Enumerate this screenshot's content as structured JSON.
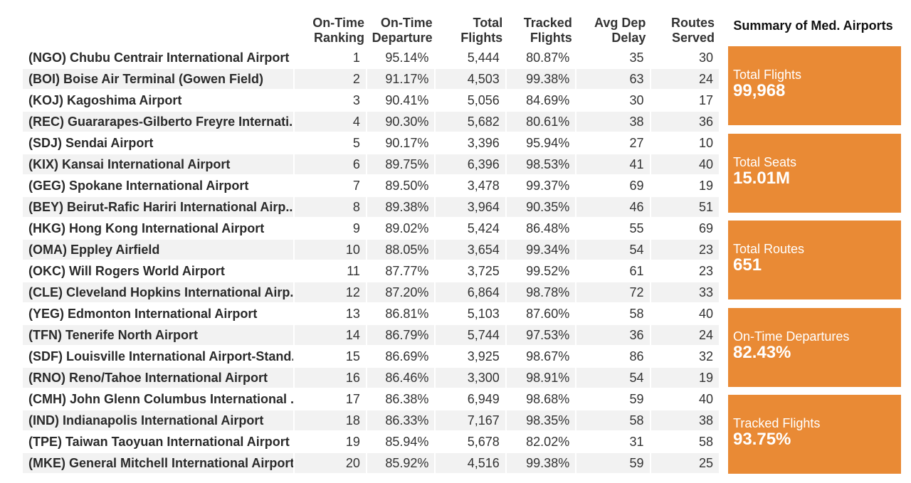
{
  "table": {
    "headers": {
      "name": "",
      "rank": [
        "On-Time",
        "Ranking"
      ],
      "departure": [
        "On-Time",
        "Departure"
      ],
      "total_flights": [
        "Total",
        "Flights"
      ],
      "tracked_flights": [
        "Tracked",
        "Flights"
      ],
      "avg_dep_delay": [
        "Avg Dep",
        "Delay"
      ],
      "routes_served": [
        "Routes",
        "Served"
      ]
    },
    "rows": [
      {
        "name": "(NGO) Chubu Centrair International Airport",
        "rank": "1",
        "departure": "95.14%",
        "total_flights": "5,444",
        "tracked_flights": "80.87%",
        "avg_dep_delay": "35",
        "routes_served": "30"
      },
      {
        "name": "(BOI) Boise Air Terminal (Gowen Field)",
        "rank": "2",
        "departure": "91.17%",
        "total_flights": "4,503",
        "tracked_flights": "99.38%",
        "avg_dep_delay": "63",
        "routes_served": "24"
      },
      {
        "name": "(KOJ) Kagoshima Airport",
        "rank": "3",
        "departure": "90.41%",
        "total_flights": "5,056",
        "tracked_flights": "84.69%",
        "avg_dep_delay": "30",
        "routes_served": "17"
      },
      {
        "name": "(REC) Guararapes-Gilberto Freyre Internati..",
        "rank": "4",
        "departure": "90.30%",
        "total_flights": "5,682",
        "tracked_flights": "80.61%",
        "avg_dep_delay": "38",
        "routes_served": "36"
      },
      {
        "name": "(SDJ) Sendai Airport",
        "rank": "5",
        "departure": "90.17%",
        "total_flights": "3,396",
        "tracked_flights": "95.94%",
        "avg_dep_delay": "27",
        "routes_served": "10"
      },
      {
        "name": "(KIX) Kansai International Airport",
        "rank": "6",
        "departure": "89.75%",
        "total_flights": "6,396",
        "tracked_flights": "98.53%",
        "avg_dep_delay": "41",
        "routes_served": "40"
      },
      {
        "name": "(GEG) Spokane International Airport",
        "rank": "7",
        "departure": "89.50%",
        "total_flights": "3,478",
        "tracked_flights": "99.37%",
        "avg_dep_delay": "69",
        "routes_served": "19"
      },
      {
        "name": "(BEY) Beirut-Rafic Hariri International Airp..",
        "rank": "8",
        "departure": "89.38%",
        "total_flights": "3,964",
        "tracked_flights": "90.35%",
        "avg_dep_delay": "46",
        "routes_served": "51"
      },
      {
        "name": "(HKG) Hong Kong International Airport",
        "rank": "9",
        "departure": "89.02%",
        "total_flights": "5,424",
        "tracked_flights": "86.48%",
        "avg_dep_delay": "55",
        "routes_served": "69"
      },
      {
        "name": "(OMA) Eppley Airfield",
        "rank": "10",
        "departure": "88.05%",
        "total_flights": "3,654",
        "tracked_flights": "99.34%",
        "avg_dep_delay": "54",
        "routes_served": "23"
      },
      {
        "name": "(OKC) Will Rogers World Airport",
        "rank": "11",
        "departure": "87.77%",
        "total_flights": "3,725",
        "tracked_flights": "99.52%",
        "avg_dep_delay": "61",
        "routes_served": "23"
      },
      {
        "name": "(CLE) Cleveland Hopkins International Airp..",
        "rank": "12",
        "departure": "87.20%",
        "total_flights": "6,864",
        "tracked_flights": "98.78%",
        "avg_dep_delay": "72",
        "routes_served": "33"
      },
      {
        "name": "(YEG) Edmonton International Airport",
        "rank": "13",
        "departure": "86.81%",
        "total_flights": "5,103",
        "tracked_flights": "87.60%",
        "avg_dep_delay": "58",
        "routes_served": "40"
      },
      {
        "name": "(TFN) Tenerife North Airport",
        "rank": "14",
        "departure": "86.79%",
        "total_flights": "5,744",
        "tracked_flights": "97.53%",
        "avg_dep_delay": "36",
        "routes_served": "24"
      },
      {
        "name": "(SDF) Louisville International Airport-Stand..",
        "rank": "15",
        "departure": "86.69%",
        "total_flights": "3,925",
        "tracked_flights": "98.67%",
        "avg_dep_delay": "86",
        "routes_served": "32"
      },
      {
        "name": "(RNO) Reno/Tahoe International Airport",
        "rank": "16",
        "departure": "86.46%",
        "total_flights": "3,300",
        "tracked_flights": "98.91%",
        "avg_dep_delay": "54",
        "routes_served": "19"
      },
      {
        "name": "(CMH) John Glenn Columbus International ..",
        "rank": "17",
        "departure": "86.38%",
        "total_flights": "6,949",
        "tracked_flights": "98.68%",
        "avg_dep_delay": "59",
        "routes_served": "40"
      },
      {
        "name": "(IND) Indianapolis International Airport",
        "rank": "18",
        "departure": "86.33%",
        "total_flights": "7,167",
        "tracked_flights": "98.35%",
        "avg_dep_delay": "58",
        "routes_served": "38"
      },
      {
        "name": "(TPE) Taiwan Taoyuan International Airport",
        "rank": "19",
        "departure": "85.94%",
        "total_flights": "5,678",
        "tracked_flights": "82.02%",
        "avg_dep_delay": "31",
        "routes_served": "58"
      },
      {
        "name": "(MKE) General Mitchell International Airport",
        "rank": "20",
        "departure": "85.92%",
        "total_flights": "4,516",
        "tracked_flights": "99.38%",
        "avg_dep_delay": "59",
        "routes_served": "25"
      }
    ]
  },
  "summary": {
    "title": "Summary of Med. Airports",
    "accent_color": "#e98a35",
    "cards": [
      {
        "label": "Total Flights",
        "value": "99,968"
      },
      {
        "label": "Total Seats",
        "value": "15.01M"
      },
      {
        "label": "Total Routes",
        "value": "651"
      },
      {
        "label": "On-Time Departures",
        "value": "82.43%"
      },
      {
        "label": "Tracked Flights",
        "value": "93.75%"
      }
    ]
  }
}
